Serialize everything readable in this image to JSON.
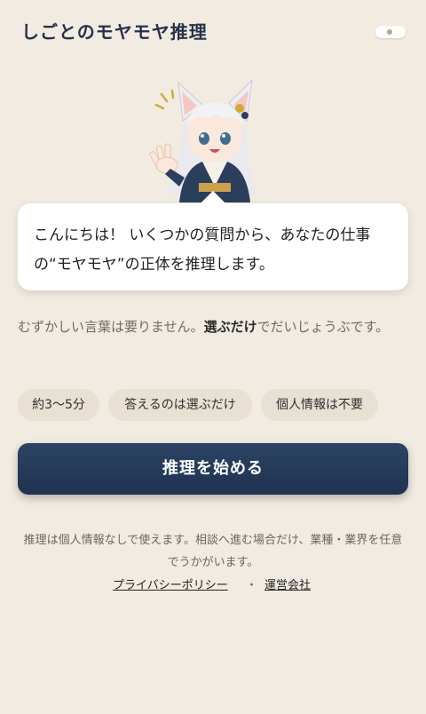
{
  "header": {
    "title": "しごとのモヤモヤ推理",
    "toggle_state": "on"
  },
  "mascot": {
    "description": "fox-eared character waving"
  },
  "bubble": {
    "text": "こんにちは！ いくつかの質問から、あなたの仕事の“モヤモヤ”の正体を推理します。"
  },
  "intro": {
    "before": "むずかしい言葉は要りません。",
    "emphasis": "選ぶだけ",
    "after": "でだいじょうぶです。"
  },
  "chips": [
    "約3〜5分",
    "答えるのは選ぶだけ",
    "個人情報は不要"
  ],
  "start_button": {
    "label": "推理を始める"
  },
  "note": "推理は個人情報なしで使えます。相談へ進む場合だけ、業種・業界を任意でうかがいます。",
  "links": {
    "privacy": "プライバシーポリシー",
    "separator": "・",
    "company": "運営会社"
  },
  "colors": {
    "accent": "#26324a",
    "background": "#f1ebe1",
    "chip": "#e8e0d3"
  }
}
